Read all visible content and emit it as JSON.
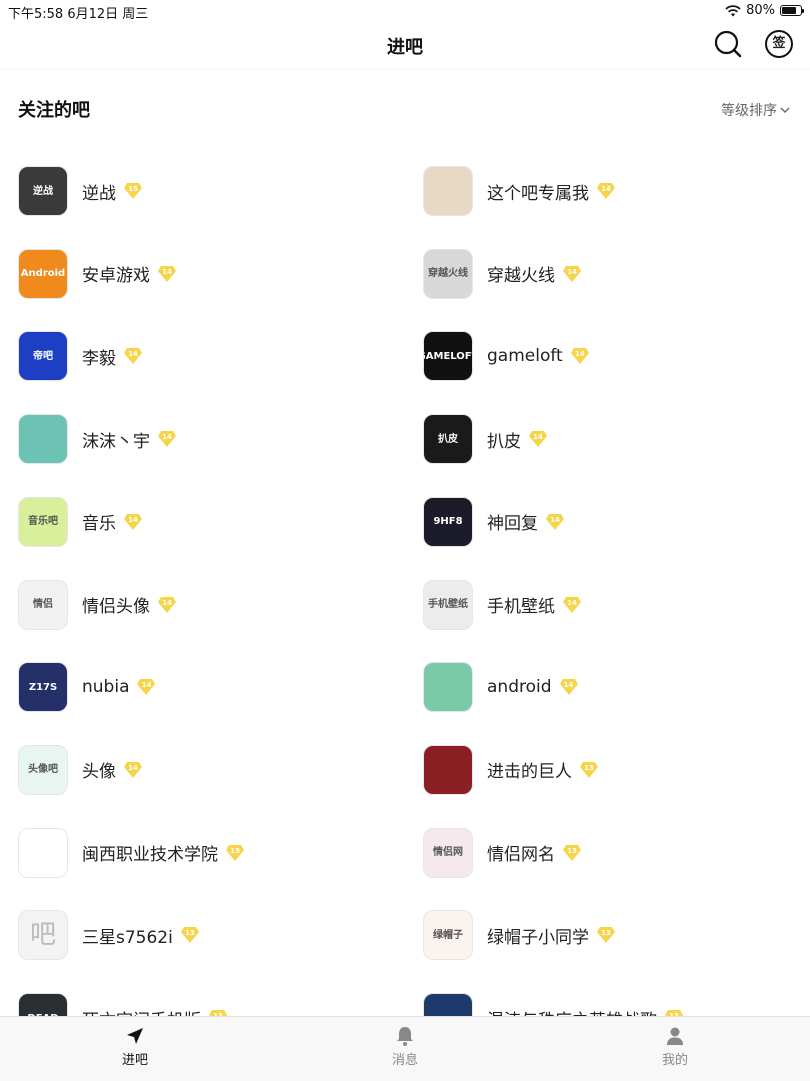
{
  "status_bar": {
    "time": "下午5:58   6月12日 周三",
    "battery": "80%",
    "battery_level": 0.8
  },
  "nav": {
    "title": "进吧",
    "search_icon": "search-icon",
    "sign_icon": "签"
  },
  "section": {
    "title": "关注的吧",
    "sort_label": "等级排序"
  },
  "forums": [
    {
      "name": "逆战",
      "level": "15",
      "avatar_text": "逆战",
      "avatar_color": "#3a3a3a"
    },
    {
      "name": "这个吧专属我",
      "level": "14",
      "avatar_text": "",
      "avatar_color": "#e8d9c4"
    },
    {
      "name": "安卓游戏",
      "level": "14",
      "avatar_text": "Android",
      "avatar_color": "#f08a1c"
    },
    {
      "name": "穿越火线",
      "level": "14",
      "avatar_text": "穿越火线",
      "avatar_color": "#d8d8d8"
    },
    {
      "name": "李毅",
      "level": "14",
      "avatar_text": "帝吧",
      "avatar_color": "#1c3fc4"
    },
    {
      "name": "gameloft",
      "level": "14",
      "avatar_text": "GAMELOFT",
      "avatar_color": "#111111"
    },
    {
      "name": "沫沫丶宇",
      "level": "14",
      "avatar_text": "",
      "avatar_color": "#6cc3b3"
    },
    {
      "name": "扒皮",
      "level": "14",
      "avatar_text": "扒皮",
      "avatar_color": "#1a1a1a"
    },
    {
      "name": "音乐",
      "level": "14",
      "avatar_text": "音乐吧",
      "avatar_color": "#d9ef9a"
    },
    {
      "name": "神回复",
      "level": "14",
      "avatar_text": "9HF8",
      "avatar_color": "#1b1b2a"
    },
    {
      "name": "情侣头像",
      "level": "14",
      "avatar_text": "情侣",
      "avatar_color": "#f2f2f2"
    },
    {
      "name": "手机壁纸",
      "level": "14",
      "avatar_text": "手机壁纸",
      "avatar_color": "#ececec"
    },
    {
      "name": "nubia",
      "level": "14",
      "avatar_text": "Z17S",
      "avatar_color": "#23306a"
    },
    {
      "name": "android",
      "level": "14",
      "avatar_text": "",
      "avatar_color": "#7ac9a8"
    },
    {
      "name": "头像",
      "level": "14",
      "avatar_text": "头像吧",
      "avatar_color": "#e9f6f0"
    },
    {
      "name": "进击的巨人",
      "level": "13",
      "avatar_text": "",
      "avatar_color": "#8a1f24"
    },
    {
      "name": "闽西职业技术学院",
      "level": "13",
      "avatar_text": "",
      "avatar_color": "#ffffff"
    },
    {
      "name": "情侣网名",
      "level": "13",
      "avatar_text": "情侣网",
      "avatar_color": "#f6e9ec"
    },
    {
      "name": "三星s7562i",
      "level": "13",
      "avatar_text": "吧",
      "avatar_color": "#f3f3f3"
    },
    {
      "name": "绿帽子小同学",
      "level": "13",
      "avatar_text": "绿帽子",
      "avatar_color": "#fbf3ef"
    },
    {
      "name": "死亡空间手机版",
      "level": "13",
      "avatar_text": "DEAD",
      "avatar_color": "#2a2f33"
    },
    {
      "name": "混沌与秩序之英雄战歌",
      "level": "13",
      "avatar_text": "",
      "avatar_color": "#1d3a6a"
    }
  ],
  "tabs": [
    {
      "label": "进吧",
      "icon": "navigation-arrow-icon",
      "active": true
    },
    {
      "label": "消息",
      "icon": "bell-icon",
      "active": false
    },
    {
      "label": "我的",
      "icon": "person-icon",
      "active": false
    }
  ],
  "colors": {
    "badge": "#f7d54a",
    "active_tab": "#111111",
    "inactive_tab": "#888888"
  }
}
